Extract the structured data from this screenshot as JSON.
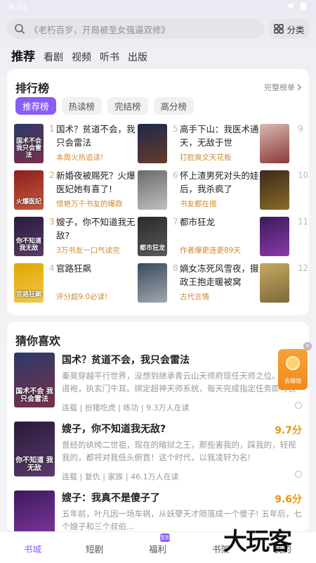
{
  "status": {
    "time": "9:01"
  },
  "search": {
    "placeholder": "《老朽百岁，开局被圣女强逼双修》",
    "category_label": "分类"
  },
  "top_nav": [
    "推荐",
    "看剧",
    "视频",
    "听书",
    "出版"
  ],
  "ranking": {
    "title": "排行榜",
    "more": "完整榜单",
    "chips": [
      "推荐榜",
      "热读榜",
      "完结榜",
      "高分榜"
    ],
    "items": [
      {
        "num": "1",
        "title": "国术？贫道不会，我只会雷法",
        "sub": "本周火热追读!",
        "cover_text": "国术不会 我只会雷法",
        "c1": "#2a3a6a",
        "c2": "#7a2f4a"
      },
      {
        "num": "2",
        "title": "新婚夜被赐死？火爆医妃她有喜了!",
        "sub": "惊艳万千书友的爆款",
        "cover_text": "火爆医妃",
        "c1": "#8a1f1f",
        "c2": "#c9563a"
      },
      {
        "num": "3",
        "title": "嫂子，你不知道我无敌?",
        "sub": "3万书友一口气读完",
        "cover_text": "你不知道 我无敌",
        "c1": "#2a1a3a",
        "c2": "#5a3a6a"
      },
      {
        "num": "4",
        "title": "官路狂飙",
        "sub": "评分超9.0必读!",
        "cover_text": "官路狂飙",
        "c1": "#e0a500",
        "c2": "#f2c94c"
      },
      {
        "num": "5",
        "title": "高手下山：我医术通天，无敌于世",
        "sub": "打脸爽文天花板",
        "cover_text": "",
        "c1": "#1a2a4a",
        "c2": "#6a3a2a"
      },
      {
        "num": "6",
        "title": "怀上渣男死对头的娃后，我杀疯了",
        "sub": "书友都在搜",
        "cover_text": "",
        "c1": "#6a6a6a",
        "c2": "#c0c0c0"
      },
      {
        "num": "7",
        "title": "都市狂龙",
        "sub": "作者爆更连更89天",
        "cover_text": "都市狂龙",
        "c1": "#2a2a2a",
        "c2": "#5a5a5a"
      },
      {
        "num": "8",
        "title": "嫡女冻死风雪夜，摄政王抱走暖被窝",
        "sub": "古代言情",
        "cover_text": "",
        "c1": "#3a4a5a",
        "c2": "#a0a8b0"
      },
      {
        "num": "9",
        "title": "",
        "sub": "",
        "cover_text": "",
        "c1": "#d8b8b0",
        "c2": "#8a3a3a"
      },
      {
        "num": "10",
        "title": "",
        "sub": "",
        "cover_text": "",
        "c1": "#3a2a1a",
        "c2": "#8a6a2a"
      },
      {
        "num": "11",
        "title": "",
        "sub": "",
        "cover_text": "",
        "c1": "#3a1a5a",
        "c2": "#8a3aaa"
      },
      {
        "num": "12",
        "title": "",
        "sub": "",
        "cover_text": "",
        "c1": "#c8a860",
        "c2": "#7a6a3a"
      }
    ]
  },
  "guess": {
    "title": "猜你喜欢",
    "books": [
      {
        "title": "国术？贫道不会，我只会雷法",
        "score": "",
        "desc": "秦昊穿越平行世界，没想到继承青云山天师府现任天师之位。身穿道袍，执玄门牛耳。绑定超神天师系统，每天完成指定任务即可获得丰",
        "tags": "连载 | 扮猪吃虎 | 练功 | 9.3万人在读",
        "cover_text": "国术不会 我只会雷法",
        "c1": "#2a3a6a",
        "c2": "#7a2f4a"
      },
      {
        "title": "嫂子，你不知道我无敌?",
        "score": "9.7分",
        "desc": "曾经的纨绔二世祖，现在的暗狱之王，那些害我的，踩我的，轻视我的，都将对我低头俯首！这个时代，以我凌轩为名!",
        "tags": "连载 | 复仇 | 家族 | 46.1万人在读",
        "cover_text": "你不知道 我无敌",
        "c1": "#2a1a3a",
        "c2": "#5a3a6a"
      },
      {
        "title": "嫂子：我真不是傻子了",
        "score": "9.6分",
        "desc": "五年前，叶凡因一场车祸，从妖孽天才陨落成一个傻子!    五年后，七个嫂子和三个叔伯...",
        "tags": "",
        "cover_text": "",
        "c1": "#3a1a5a",
        "c2": "#8a3aaa"
      }
    ]
  },
  "float_ad": {
    "label": "去赚钱"
  },
  "tabbar": {
    "tabs": [
      "书城",
      "短剧",
      "福利",
      "书架",
      "我的"
    ],
    "badge": "签到"
  },
  "watermark": "大玩客",
  "colors": {
    "accent": "#8b5cf6",
    "highlight": "#f0930f"
  }
}
